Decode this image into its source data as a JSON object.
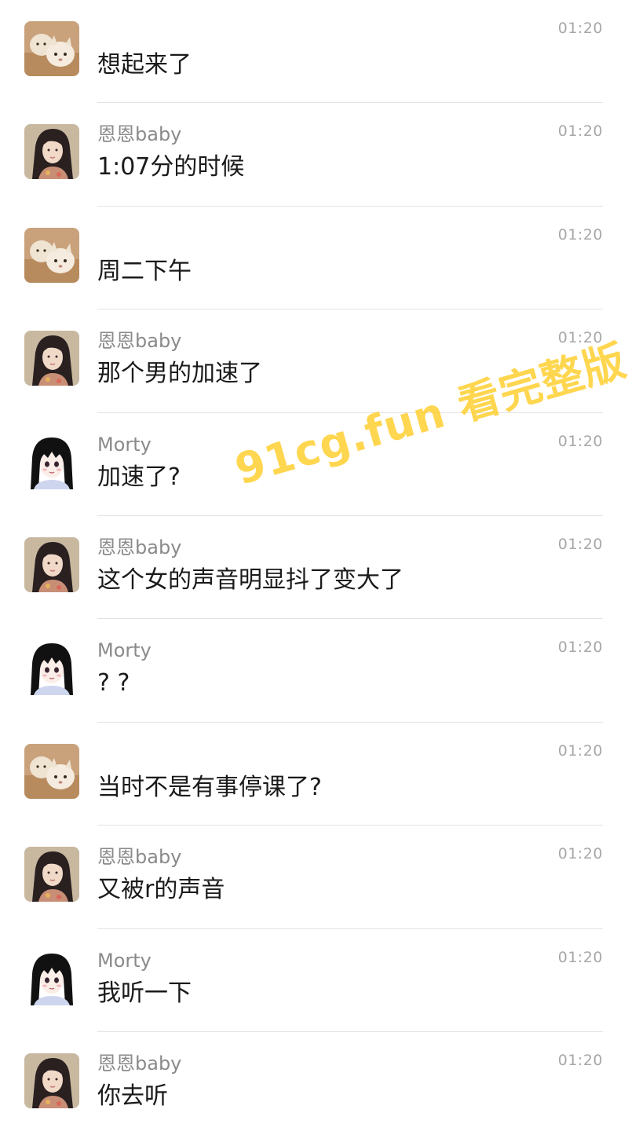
{
  "messages": [
    {
      "sender": "",
      "avatar": "cat",
      "time": "01:20",
      "text": "想起来了"
    },
    {
      "sender": "恩恩baby",
      "avatar": "girl-photo",
      "time": "01:20",
      "text": "1:07分的时候"
    },
    {
      "sender": "",
      "avatar": "cat",
      "time": "01:20",
      "text": "周二下午"
    },
    {
      "sender": "恩恩baby",
      "avatar": "girl-photo",
      "time": "01:20",
      "text": "那个男的加速了"
    },
    {
      "sender": "Morty",
      "avatar": "anime-girl",
      "time": "01:20",
      "text": "加速了?"
    },
    {
      "sender": "恩恩baby",
      "avatar": "girl-photo",
      "time": "01:20",
      "text": "这个女的声音明显抖了变大了"
    },
    {
      "sender": "Morty",
      "avatar": "anime-girl",
      "time": "01:20",
      "text": "? ?"
    },
    {
      "sender": "",
      "avatar": "cat",
      "time": "01:20",
      "text": "当时不是有事停课了?"
    },
    {
      "sender": "恩恩baby",
      "avatar": "girl-photo",
      "time": "01:20",
      "text": "又被r的声音"
    },
    {
      "sender": "Morty",
      "avatar": "anime-girl",
      "time": "01:20",
      "text": "我听一下"
    },
    {
      "sender": "恩恩baby",
      "avatar": "girl-photo",
      "time": "01:20",
      "text": "你去听"
    }
  ],
  "watermark": "91cg.fun 看完整版",
  "colors": {
    "background": "#ffffff",
    "sender": "#8a8a8a",
    "time": "#a8a8a8",
    "text": "#1a1a1a",
    "divider": "#e3e3e3",
    "watermark": "#ffcd28"
  }
}
